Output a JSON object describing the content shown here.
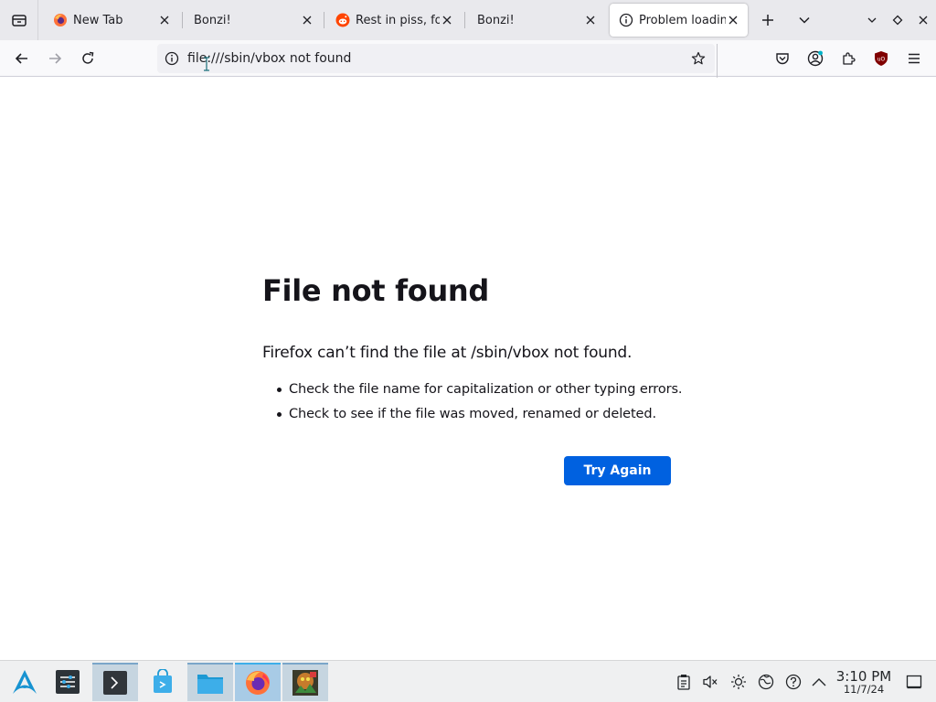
{
  "browser": {
    "tabs": [
      {
        "title": "New Tab",
        "favicon": "firefox-icon",
        "selected": false
      },
      {
        "title": "Bonzi!",
        "favicon": "none",
        "selected": false
      },
      {
        "title": "Rest in piss, for",
        "favicon": "reddit-icon",
        "selected": false
      },
      {
        "title": "Bonzi!",
        "favicon": "none",
        "selected": false
      },
      {
        "title": "Problem loadin",
        "favicon": "info-icon",
        "selected": true
      }
    ],
    "address": "file:///sbin/vbox not found",
    "toolbar_icons": [
      "pocket-icon",
      "account-icon",
      "extensions-icon",
      "ublock-origin-icon",
      "menu-icon"
    ]
  },
  "error_page": {
    "title": "File not found",
    "description": "Firefox can’t find the file at /sbin/vbox not found.",
    "suggestions": [
      "Check the file name for capitalization or other typing errors.",
      "Check to see if the file was moved, renamed or deleted."
    ],
    "try_again_label": "Try Again"
  },
  "taskbar": {
    "apps": [
      "app-launcher-icon",
      "system-settings-icon",
      "terminal-icon",
      "discover-store-icon",
      "file-manager-icon",
      "firefox-icon",
      "image-viewer-icon"
    ],
    "tray": [
      "clipboard-icon",
      "volume-muted-icon",
      "brightness-icon",
      "network-icon",
      "help-icon",
      "tray-expand-icon"
    ],
    "time": "3:10 PM",
    "date": "11/7/24"
  },
  "colors": {
    "accent": "#0061e0",
    "tabstrip_bg": "#e9e9ed",
    "taskbar_bg": "#eff0f1",
    "ublock_red": "#800000"
  }
}
